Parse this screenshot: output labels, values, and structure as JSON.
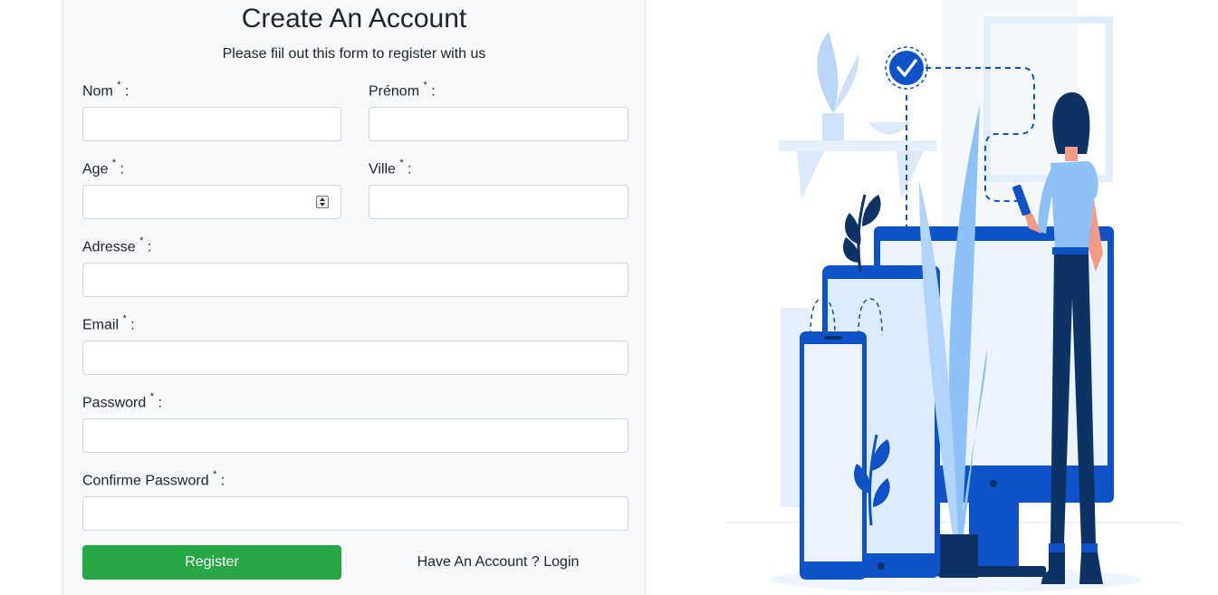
{
  "form": {
    "title": "Create An Account",
    "subtitle": "Please fiil out this form to register with us",
    "required_marker": "*",
    "fields": {
      "nom": {
        "label": "Nom",
        "value": ""
      },
      "prenom": {
        "label": "Prénom",
        "value": ""
      },
      "age": {
        "label": "Age",
        "value": ""
      },
      "ville": {
        "label": "Ville",
        "value": ""
      },
      "adresse": {
        "label": "Adresse",
        "value": ""
      },
      "email": {
        "label": "Email",
        "value": ""
      },
      "password": {
        "label": "Password",
        "value": ""
      },
      "confirm_password": {
        "label": "Confirme Password",
        "value": ""
      }
    },
    "label_suffix": ":",
    "register_label": "Register",
    "login_link_label": "Have An Account ? Login"
  },
  "colors": {
    "register_button": "#28a745",
    "illustration_blue": "#0d52c6",
    "illustration_light_blue": "#8ec1f7",
    "illustration_navy": "#0d3364"
  },
  "illustration": {
    "icon": "registration-illustration"
  }
}
